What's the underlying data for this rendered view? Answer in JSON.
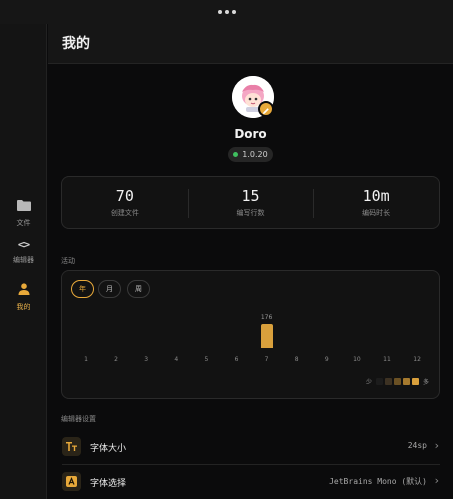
{
  "window": {
    "menu_icon": "more-dots-icon"
  },
  "sidebar": {
    "items": [
      {
        "label": "文件",
        "icon": "folder-icon"
      },
      {
        "label": "编辑器",
        "icon": "code-icon"
      },
      {
        "label": "我的",
        "icon": "user-icon",
        "active": true
      }
    ]
  },
  "header": {
    "title": "我的"
  },
  "profile": {
    "username": "Doro",
    "version": "1.0.20",
    "version_status_color": "#3fbf5f"
  },
  "stats": [
    {
      "value": "70",
      "label": "创建文件"
    },
    {
      "value": "15",
      "label": "编写行数"
    },
    {
      "value": "10m",
      "label": "编码时长"
    }
  ],
  "activity": {
    "section_label": "活动",
    "tabs": [
      "年",
      "月",
      "周"
    ],
    "active_tab": "年",
    "legend": {
      "less": "少",
      "more": "多",
      "colors": [
        "#1c1c1c",
        "#3d3223",
        "#6b5124",
        "#a67a2e",
        "#d9a03c"
      ]
    }
  },
  "chart_data": {
    "type": "bar",
    "categories": [
      "1",
      "2",
      "3",
      "4",
      "5",
      "6",
      "7",
      "8",
      "9",
      "10",
      "11",
      "12"
    ],
    "values": [
      0,
      0,
      0,
      0,
      0,
      0,
      176,
      0,
      0,
      0,
      0,
      0
    ],
    "data_labels": [
      "",
      "",
      "",
      "",
      "",
      "",
      "176",
      "",
      "",
      "",
      "",
      ""
    ],
    "bar_color": "#d9a03c",
    "grid": false
  },
  "settings": {
    "section_label": "编辑器设置",
    "rows": [
      {
        "name": "字体大小",
        "value": "24sp",
        "icon": "font-size-icon"
      },
      {
        "name": "字体选择",
        "value": "JetBrains Mono (默认)",
        "icon": "font-family-icon"
      }
    ]
  },
  "accent_color": "#e8a93a"
}
